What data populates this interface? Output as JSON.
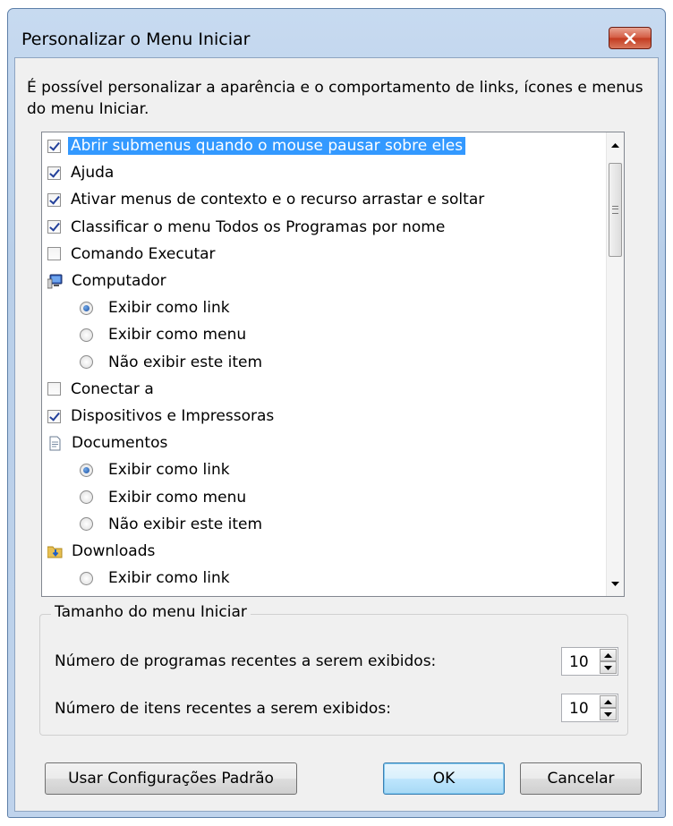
{
  "window": {
    "title": "Personalizar o Menu Iniciar",
    "description": "É possível personalizar a aparência e o comportamento de links, ícones e menus do menu Iniciar."
  },
  "colors": {
    "selection": "#3399ff",
    "close_button": "#c7432a",
    "titlebar": "#bfd3ec"
  },
  "list": {
    "items": [
      {
        "type": "checkbox",
        "checked": true,
        "label": "Abrir submenus quando o mouse pausar sobre eles",
        "selected": true
      },
      {
        "type": "checkbox",
        "checked": true,
        "label": "Ajuda"
      },
      {
        "type": "checkbox",
        "checked": true,
        "label": "Ativar menus de contexto e o recurso arrastar e soltar"
      },
      {
        "type": "checkbox",
        "checked": true,
        "label": "Classificar o menu Todos os Programas por nome"
      },
      {
        "type": "checkbox",
        "checked": false,
        "label": "Comando Executar"
      },
      {
        "type": "header",
        "icon": "computer-icon",
        "label": "Computador"
      },
      {
        "type": "radio",
        "checked": true,
        "label": "Exibir como link"
      },
      {
        "type": "radio",
        "checked": false,
        "label": "Exibir como menu"
      },
      {
        "type": "radio",
        "checked": false,
        "label": "Não exibir este item"
      },
      {
        "type": "checkbox",
        "checked": false,
        "label": "Conectar a"
      },
      {
        "type": "checkbox",
        "checked": true,
        "label": "Dispositivos e Impressoras"
      },
      {
        "type": "header",
        "icon": "documents-icon",
        "label": "Documentos"
      },
      {
        "type": "radio",
        "checked": true,
        "label": "Exibir como link"
      },
      {
        "type": "radio",
        "checked": false,
        "label": "Exibir como menu"
      },
      {
        "type": "radio",
        "checked": false,
        "label": "Não exibir este item"
      },
      {
        "type": "header",
        "icon": "downloads-folder-icon",
        "label": "Downloads"
      },
      {
        "type": "radio",
        "checked": false,
        "label": "Exibir como link"
      }
    ]
  },
  "size_group": {
    "legend": "Tamanho do menu Iniciar",
    "recent_programs_label": "Número de programas recentes a serem exibidos:",
    "recent_programs_value": "10",
    "recent_items_label": "Número de itens recentes a serem exibidos:",
    "recent_items_value": "10"
  },
  "buttons": {
    "defaults": "Usar Configurações Padrão",
    "ok": "OK",
    "cancel": "Cancelar"
  }
}
